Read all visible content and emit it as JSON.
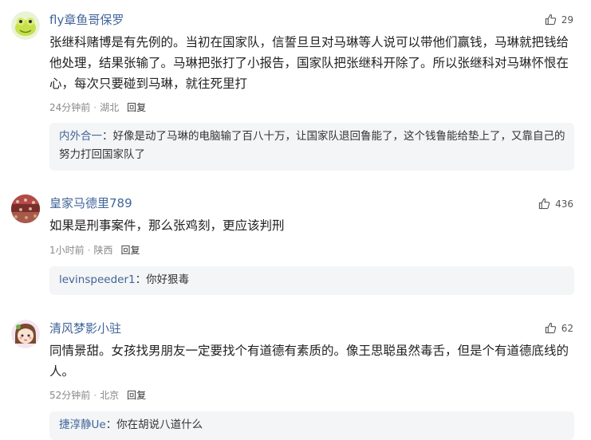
{
  "colors": {
    "username": "#406599",
    "meta": "#888888",
    "reply_bg": "#f4f5f6"
  },
  "comments": [
    {
      "username": "fly章鱼哥保罗",
      "likes": "29",
      "text": "张继科赌博是有先例的。当初在国家队，信誓旦旦对马琳等人说可以带他们赢钱，马琳就把钱给他处理，结果张输了。马琳把张打了小报告，国家队把张继科开除了。所以张继科对马琳怀恨在心，每次只要碰到马琳，就往死里打",
      "time": "24分钟前",
      "location": "湖北",
      "reply_label": "回复",
      "sub_reply": {
        "name": "内外合一",
        "text": "：好像是动了马琳的电脑输了百八十万，让国家队退回鲁能了，这个钱鲁能给垫上了，又靠自己的努力打回国家队了"
      }
    },
    {
      "username": "皇家马德里789",
      "likes": "436",
      "text": "如果是刑事案件，那么张鸡刻，更应该判刑",
      "time": "1小时前",
      "location": "陕西",
      "reply_label": "回复",
      "sub_reply": {
        "name": "levinspeeder1",
        "text": "：你好狠毒"
      }
    },
    {
      "username": "清风梦影小驻",
      "likes": "62",
      "text": "同情景甜。女孩找男朋友一定要找个有道德有素质的。像王思聪虽然毒舌，但是个有道德底线的人。",
      "time": "52分钟前",
      "location": "北京",
      "reply_label": "回复",
      "sub_reply": {
        "name": "捷淳静Ue",
        "text": "：你在胡说八道什么"
      }
    }
  ]
}
